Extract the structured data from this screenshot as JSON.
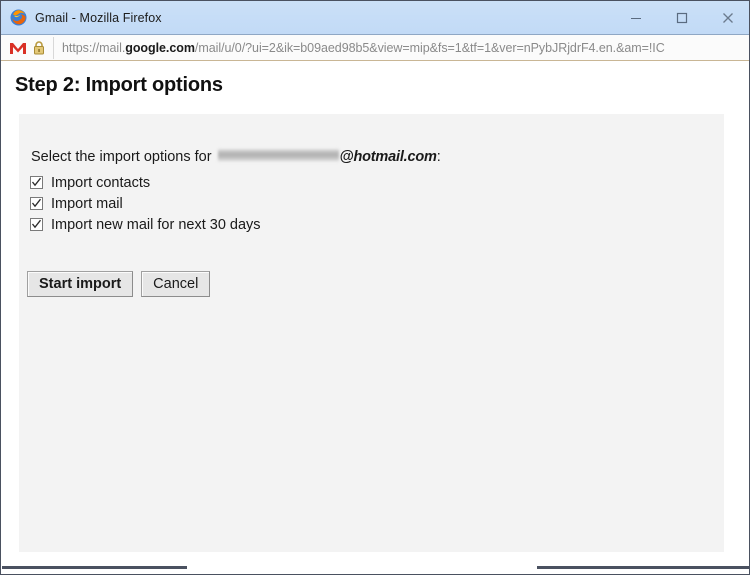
{
  "window": {
    "title": "Gmail - Mozilla Firefox",
    "app_icon": "firefox-icon",
    "controls": {
      "minimize": "minimize-icon",
      "maximize": "maximize-icon",
      "close": "close-icon"
    },
    "titlebar_color": "#c6ddf7"
  },
  "urlbar": {
    "site_icon": "gmail-m-icon",
    "security_icon": "padlock-icon",
    "url_scheme": "https://mail.",
    "url_domain": "google.com",
    "url_path": "/mail/u/0/?ui=2&ik=b09aed98b5&view=mip&fs=1&tf=1&ver=nPybJRjdrF4.en.&am=!IC",
    "url_full": "https://mail.google.com/mail/u/0/?ui=2&ik=b09aed98b5&view=mip&fs=1&tf=1&ver=nPybJRjdrF4.en.&am=!IC"
  },
  "page": {
    "heading": "Step 2: Import options",
    "intro_prefix": "Select the import options for ",
    "intro_account_redacted": "",
    "intro_domain": "@hotmail.com",
    "intro_suffix": ":",
    "checkboxes": [
      {
        "label": "Import contacts",
        "checked": true
      },
      {
        "label": "Import mail",
        "checked": true
      },
      {
        "label": "Import new mail for next 30 days",
        "checked": true
      }
    ],
    "buttons": {
      "primary": "Start import",
      "secondary": "Cancel"
    },
    "panel_color": "#f3f3f3"
  },
  "scrollbar": {
    "orientation": "horizontal",
    "thumb_color": "#4a5160"
  }
}
